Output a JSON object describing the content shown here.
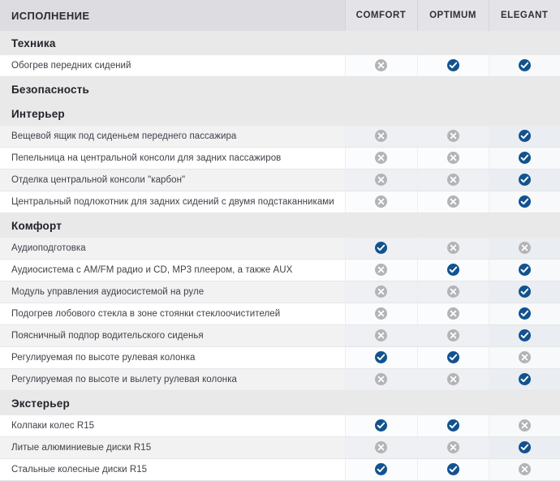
{
  "header": {
    "title": "ИСПОЛНЕНИЕ",
    "columns": [
      "COMFORT",
      "OPTIMUM",
      "ELEGANT"
    ]
  },
  "colors": {
    "header_bg": "#dcdce1",
    "column_header_bg": "#e4e4e8",
    "section_bg": "#e9e9ea",
    "row_odd_bg": "#ffffff",
    "row_even_bg": "#f2f2f3",
    "yes_mark": "#12538f",
    "no_mark": "#b4b4b7",
    "text": "#40404a"
  },
  "icons": {
    "yes": "check-circle-icon",
    "no": "cross-circle-icon"
  },
  "sections": [
    {
      "title": "Техника",
      "rows": [
        {
          "name": "Обогрев передних сидений",
          "values": [
            "no",
            "yes",
            "yes"
          ]
        }
      ]
    },
    {
      "title": "Безопасность",
      "rows": []
    },
    {
      "title": "Интерьер",
      "rows": [
        {
          "name": "Вещевой ящик под сиденьем переднего пассажира",
          "values": [
            "no",
            "no",
            "yes"
          ]
        },
        {
          "name": "Пепельница на центральной консоли для задних пассажиров",
          "values": [
            "no",
            "no",
            "yes"
          ]
        },
        {
          "name": "Отделка центральной консоли \"карбон\"",
          "values": [
            "no",
            "no",
            "yes"
          ]
        },
        {
          "name": "Центральный подлокотник для задних сидений с двумя подстаканниками",
          "values": [
            "no",
            "no",
            "yes"
          ]
        }
      ]
    },
    {
      "title": "Комфорт",
      "rows": [
        {
          "name": "Аудиоподготовка",
          "values": [
            "yes",
            "no",
            "no"
          ]
        },
        {
          "name": "Аудиосистема с AM/FM радио и CD, MP3 плеером, а также AUX",
          "values": [
            "no",
            "yes",
            "yes"
          ]
        },
        {
          "name": "Модуль управления аудиосистемой на руле",
          "values": [
            "no",
            "no",
            "yes"
          ]
        },
        {
          "name": "Подогрев лобового стекла в зоне стоянки стеклоочистителей",
          "values": [
            "no",
            "no",
            "yes"
          ]
        },
        {
          "name": "Поясничный подпор водительского сиденья",
          "values": [
            "no",
            "no",
            "yes"
          ]
        },
        {
          "name": "Регулируемая по высоте рулевая колонка",
          "values": [
            "yes",
            "yes",
            "no"
          ]
        },
        {
          "name": "Регулируемая по высоте и вылету рулевая колонка",
          "values": [
            "no",
            "no",
            "yes"
          ]
        }
      ]
    },
    {
      "title": "Экстерьер",
      "rows": [
        {
          "name": "Колпаки колес R15",
          "values": [
            "yes",
            "yes",
            "no"
          ]
        },
        {
          "name": "Литые алюминиевые диски R15",
          "values": [
            "no",
            "no",
            "yes"
          ]
        },
        {
          "name": "Стальные колесные диски R15",
          "values": [
            "yes",
            "yes",
            "no"
          ]
        }
      ]
    }
  ]
}
